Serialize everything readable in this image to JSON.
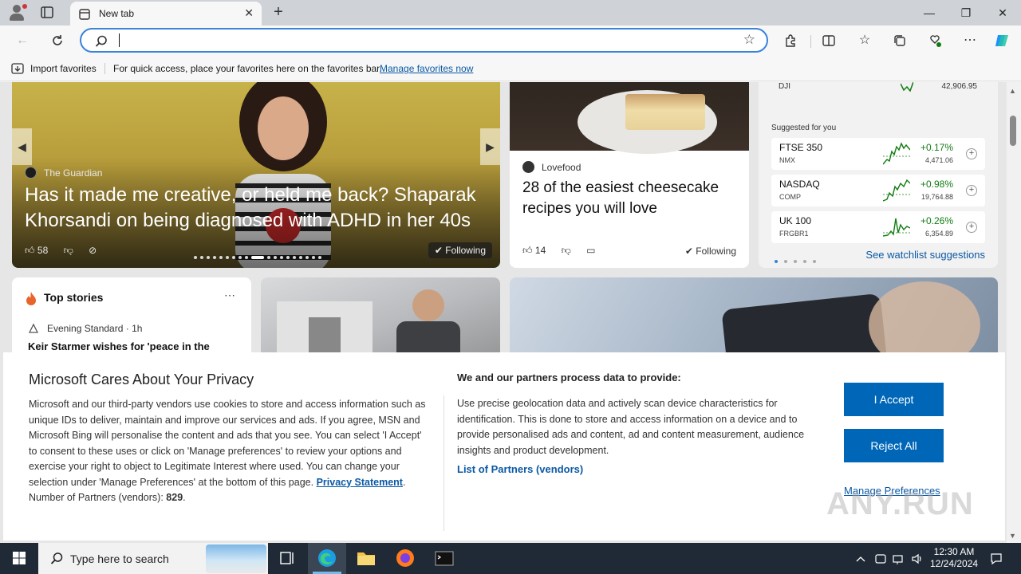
{
  "browser": {
    "tab_title": "New tab",
    "address_placeholder": "",
    "address_value": ""
  },
  "favorites_bar": {
    "import_label": "Import favorites",
    "message": "For quick access, place your favorites here on the favorites bar.",
    "manage_link": "Manage favorites now"
  },
  "hero": {
    "source": "The Guardian",
    "headline": "Has it made me creative, or held me back? Shaparak Khorsandi on being diagnosed with ADHD in her 40s",
    "likes": "58",
    "follow_label": "Following"
  },
  "food_card": {
    "source": "Lovefood",
    "headline": "28 of the easiest cheesecake recipes you will love",
    "likes": "14",
    "follow_label": "Following"
  },
  "stocks": {
    "top_row": {
      "name": "DJI",
      "value": "42,906.95"
    },
    "suggested_label": "Suggested for you",
    "rows": [
      {
        "name": "FTSE 350",
        "exchange": "NMX",
        "change": "+0.17%",
        "value": "4,471.06"
      },
      {
        "name": "NASDAQ",
        "exchange": "COMP",
        "change": "+0.98%",
        "value": "19,764.88"
      },
      {
        "name": "UK 100",
        "exchange": "FRGBR1",
        "change": "+0.26%",
        "value": "6,354.89"
      }
    ],
    "watchlist_link": "See watchlist suggestions",
    "positive_color": "#107c10"
  },
  "top_stories": {
    "title": "Top stories",
    "source": "Evening Standard · 1h",
    "headline": "Keir Starmer wishes for 'peace in the"
  },
  "privacy": {
    "title": "Microsoft Cares About Your Privacy",
    "body_1": "Microsoft and our third-party vendors use cookies to store and access information such as unique IDs to deliver, maintain and improve our services and ads. If you agree, MSN and Microsoft Bing will personalise the content and ads that you see. You can select 'I Accept' to consent to these uses or click on 'Manage preferences' to review your options and exercise your right to object to Legitimate Interest where used.  You can change your selection under 'Manage Preferences' at the bottom of this page.",
    "privacy_link": "Privacy Statement",
    "partners_label": "Number of Partners (vendors):",
    "partners_count": "829",
    "heading_2": "We and our partners process data to provide:",
    "body_2": "Use precise geolocation data and actively scan device characteristics for identification. This is done to store and access information on a device and to provide personalised ads and content, ad and content measurement, audience insights and product development.",
    "partners_link": "List of Partners (vendors)",
    "accept_label": "I Accept",
    "reject_label": "Reject All",
    "manage_label": "Manage Preferences",
    "accent_color": "#0067b8"
  },
  "watermark": "ANY.RUN",
  "taskbar": {
    "search_placeholder": "Type here to search",
    "time": "12:30 AM",
    "date": "12/24/2024"
  }
}
